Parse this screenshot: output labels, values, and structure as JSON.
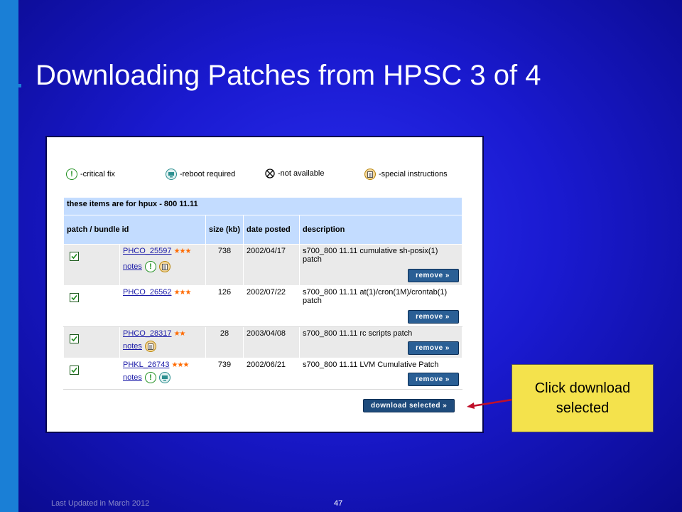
{
  "slide": {
    "title": "Downloading Patches from HPSC 3 of 4",
    "footer_left": "Last Updated in March 2012",
    "page_number": "47",
    "callout": "Click download selected"
  },
  "legend": [
    {
      "icon": "exclamation-icon",
      "label": "-critical fix"
    },
    {
      "icon": "reboot-icon",
      "label": "-reboot required"
    },
    {
      "icon": "not-available-icon",
      "label": "-not available"
    },
    {
      "icon": "special-instructions-icon",
      "label": "-special instructions"
    }
  ],
  "table": {
    "items_for_prefix": "these items are for hpux - 800 ",
    "items_for_version": "11.11",
    "headers": {
      "id": "patch / bundle id",
      "size": "size (kb)",
      "date": "date posted",
      "desc": "description"
    },
    "rows": [
      {
        "id": "PHCO_25597",
        "stars": "★★★",
        "notes": "notes",
        "size": "738",
        "date": "2002/04/17",
        "desc": "s700_800 11.11 cumulative sh-posix(1) patch",
        "remove": "remove »"
      },
      {
        "id": "PHCO_26562",
        "stars": "★★★",
        "notes": "",
        "size": "126",
        "date": "2002/07/22",
        "desc": "s700_800 11.11 at(1)/cron(1M)/crontab(1) patch",
        "remove": "remove »"
      },
      {
        "id": "PHCO_28317",
        "stars": "★★",
        "notes": "notes",
        "size": "28",
        "date": "2003/04/08",
        "desc": "s700_800 11.11 rc scripts patch",
        "remove": "remove »"
      },
      {
        "id": "PHKL_26743",
        "stars": "★★★",
        "notes": "notes",
        "size": "739",
        "date": "2002/06/21",
        "desc": "s700_800 11.11 LVM Cumulative Patch",
        "remove": "remove »"
      }
    ]
  },
  "download_button": "download selected »",
  "colors": {
    "background": "#1a1ad0",
    "left_bar": "#1a7fd6",
    "header_row": "#c3dcff",
    "stars": "#ff6a00",
    "callout": "#f4e24c",
    "button": "#2a5f95"
  }
}
